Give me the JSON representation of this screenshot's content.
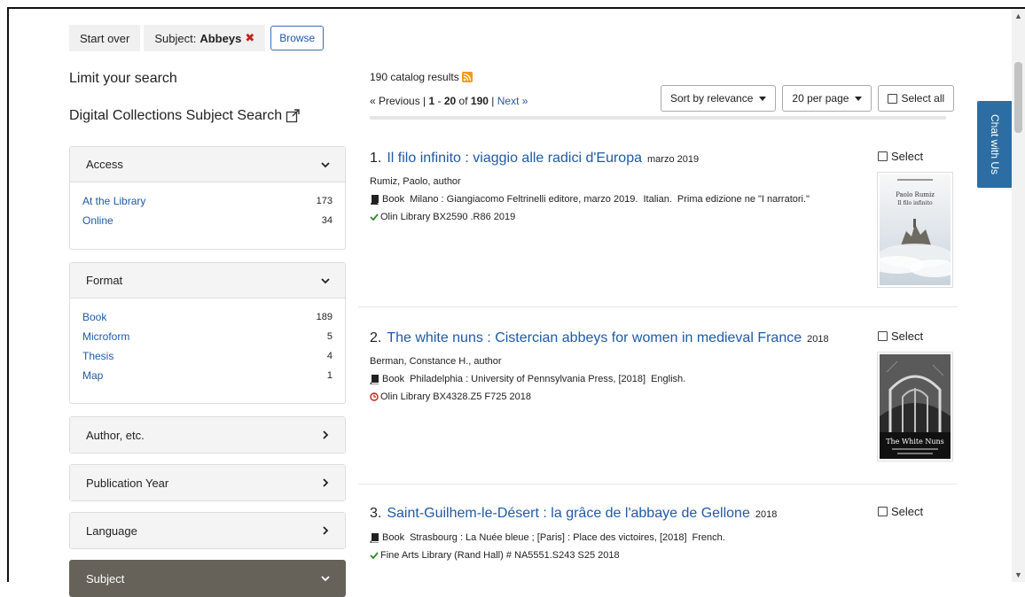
{
  "breadcrumb": {
    "start_over": "Start over",
    "subject_label": "Subject:",
    "subject_value": "Abbeys",
    "remove_glyph": "✖",
    "browse": "Browse"
  },
  "sidebar": {
    "limit_title": "Limit your search",
    "dc_title": "Digital Collections Subject Search",
    "facets": [
      {
        "label": "Access",
        "items": [
          {
            "label": "At the Library",
            "count": "173"
          },
          {
            "label": "Online",
            "count": "34"
          }
        ]
      },
      {
        "label": "Format",
        "items": [
          {
            "label": "Book",
            "count": "189"
          },
          {
            "label": "Microform",
            "count": "5"
          },
          {
            "label": "Thesis",
            "count": "4"
          },
          {
            "label": "Map",
            "count": "1"
          }
        ]
      },
      {
        "label": "Author, etc."
      },
      {
        "label": "Publication Year"
      },
      {
        "label": "Language"
      },
      {
        "label": "Subject"
      }
    ]
  },
  "results": {
    "count_text": "190 catalog results",
    "pager": {
      "previous": "« Previous",
      "sep1": " | ",
      "from": "1",
      "dash": " - ",
      "to": "20",
      "of": " of ",
      "total": "190",
      "sep2": " | ",
      "next": "Next »"
    },
    "sort_label": "Sort by relevance",
    "per_page_label": "20 per page",
    "select_all_label": "Select all",
    "select_label": "Select",
    "docs": [
      {
        "num": "1.",
        "title": "Il filo infinito : viaggio alle radici d'Europa",
        "date": "marzo 2019",
        "author": "Rumiz, Paolo, author",
        "format": "Book",
        "publisher": "Milano : Giangiacomo Feltrinelli editore, marzo 2019.",
        "language": "Italian.",
        "edition": "Prima edizione ne \"I narratori.\"",
        "availability": "Olin Library BX2590 .R86 2019",
        "cover_author": "Paolo Rumiz",
        "cover_title": "Il filo infinito"
      },
      {
        "num": "2.",
        "title": "The white nuns : Cistercian abbeys for women in medieval France",
        "date": "2018",
        "author": "Berman, Constance H., author",
        "format": "Book",
        "publisher": "Philadelphia : University of Pennsylvania Press, [2018]",
        "language": "English.",
        "availability": "Olin Library BX4328.Z5 F725 2018",
        "cover_title": "The White Nuns"
      },
      {
        "num": "3.",
        "title": "Saint-Guilhem-le-Désert : la grâce de l'abbaye de Gellone",
        "date": "2018",
        "format": "Book",
        "publisher": "Strasbourg : La Nuée bleue ; [Paris] : Place des victoires, [2018]",
        "language": "French.",
        "availability": "Fine Arts Library (Rand Hall) # NA5551.S243 S25 2018"
      }
    ]
  },
  "chat": {
    "label": "Chat with Us"
  },
  "colors": {
    "link": "#1f5aa6",
    "available": "#2e8b2e",
    "unavailable": "#c3211a",
    "chat": "#2c6ea3"
  }
}
